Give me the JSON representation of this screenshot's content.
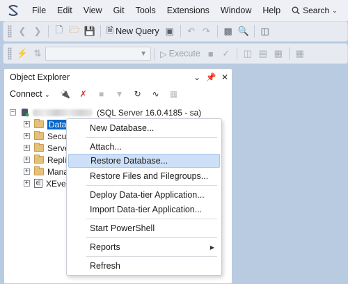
{
  "menubar": {
    "items": [
      "File",
      "Edit",
      "View",
      "Git",
      "Tools",
      "Extensions",
      "Window",
      "Help"
    ],
    "search_label": "Search"
  },
  "toolbar": {
    "new_query_label": "New Query",
    "execute_label": "Execute"
  },
  "object_explorer": {
    "title": "Object Explorer",
    "connect_label": "Connect",
    "server_suffix": "(SQL Server 16.0.4185 - sa)",
    "nodes": [
      "Datab",
      "Secur",
      "Serve",
      "Replic",
      "Mana",
      "XEver"
    ]
  },
  "context_menu": {
    "items": [
      "New Database...",
      "Attach...",
      "Restore Database...",
      "Restore Files and Filegroups...",
      "Deploy Data-tier Application...",
      "Import Data-tier Application...",
      "Start PowerShell",
      "Reports",
      "Refresh"
    ]
  },
  "colors": {
    "background": "#b8cbe0",
    "selection": "#0066cc",
    "menu_hover": "#cde0f7"
  }
}
